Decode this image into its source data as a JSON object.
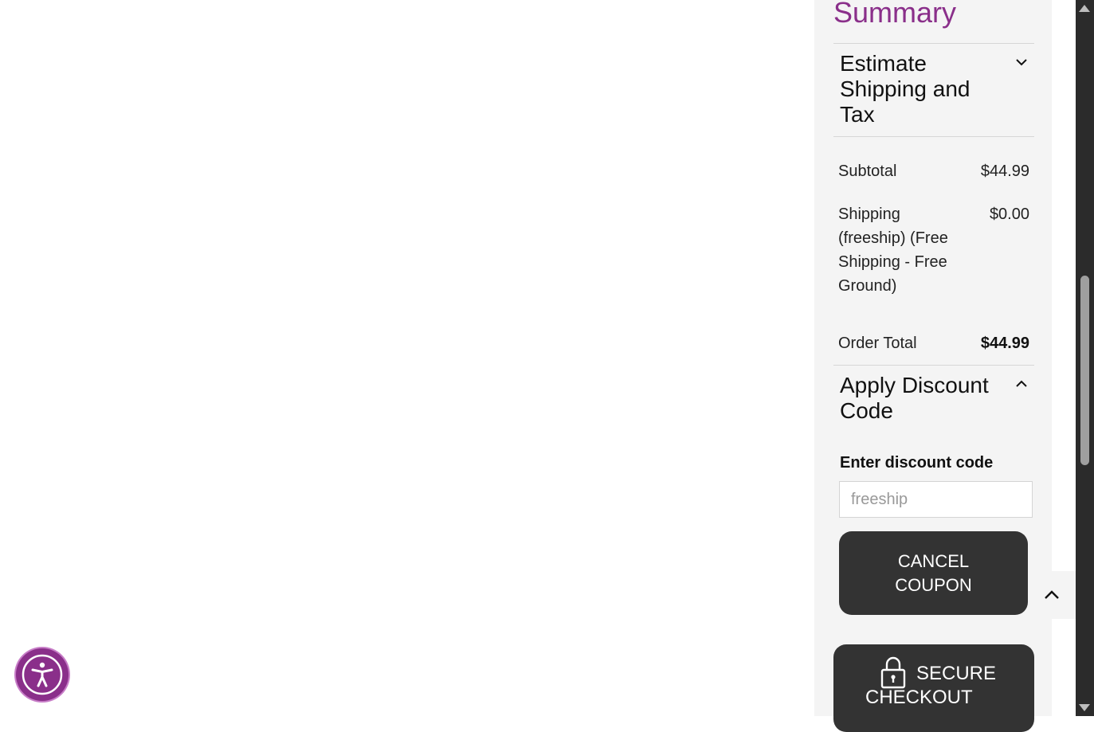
{
  "summary": {
    "title": "Summary",
    "estimate_shipping": {
      "title": "Estimate Shipping and Tax",
      "chevron_icon": "chevron-down-icon"
    },
    "rows": {
      "subtotal": {
        "label": "Subtotal",
        "value": "$44.99"
      },
      "shipping": {
        "label": "Shipping (freeship) (Free Shipping - Free Ground)",
        "value": "$0.00"
      },
      "order_total": {
        "label": "Order Total",
        "value": "$44.99"
      }
    },
    "discount": {
      "title": "Apply Discount Code",
      "chevron_icon": "chevron-up-icon",
      "field_label": "Enter discount code",
      "input_value": "freeship",
      "cancel_label": "CANCEL COUPON"
    },
    "checkout": {
      "label_line1": "SECURE",
      "label_line2": "CHECKOUT",
      "icon": "lock-icon"
    }
  },
  "back_to_top": {
    "icon": "chevron-up-icon"
  },
  "accessibility": {
    "icon": "accessibility-icon"
  },
  "colors": {
    "accent": "#8a2f8a",
    "button": "#333333",
    "panel": "#f4f4f4"
  }
}
